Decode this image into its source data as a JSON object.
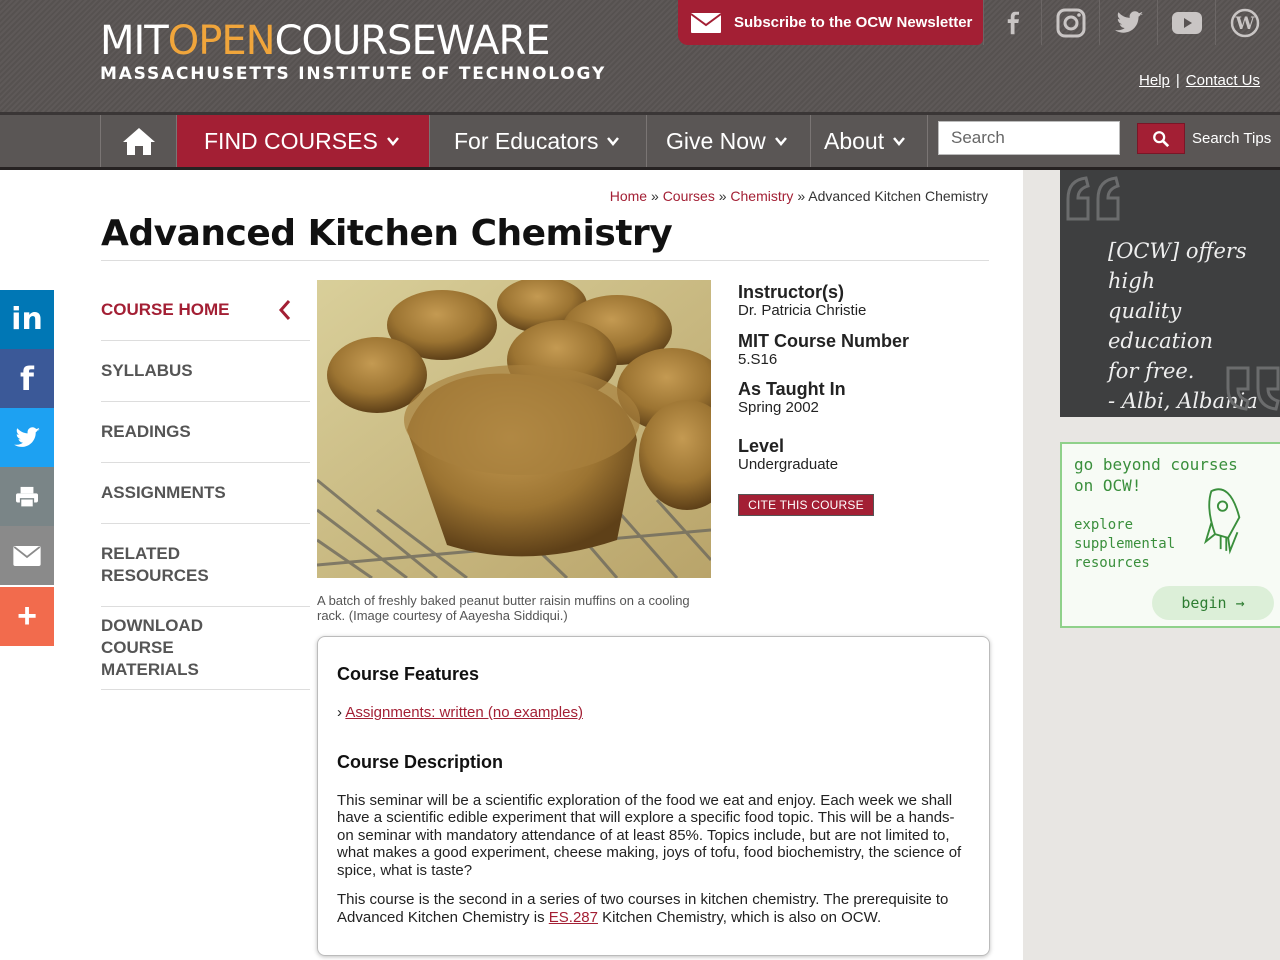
{
  "header": {
    "logo_mit": "MIT",
    "logo_open": "OPEN",
    "logo_courseware": "COURSEWARE",
    "logo_sub": "MASSACHUSETTS INSTITUTE OF TECHNOLOGY",
    "newsletter": "Subscribe to the OCW Newsletter",
    "social_icons": [
      "facebook-icon",
      "instagram-icon",
      "twitter-icon",
      "youtube-icon",
      "wordpress-icon"
    ],
    "help": "Help",
    "separator": "|",
    "contact": "Contact Us"
  },
  "nav": {
    "find_courses": "FIND COURSES",
    "for_educators": "For Educators",
    "give_now": "Give Now",
    "about": "About",
    "search_placeholder": "Search",
    "search_tips": "Search Tips"
  },
  "share": [
    {
      "icon": "linkedin-icon",
      "glyph": "in",
      "color": "#0077b5"
    },
    {
      "icon": "facebook-icon",
      "glyph": "f",
      "color": "#3b5998"
    },
    {
      "icon": "twitter-icon",
      "glyph": "",
      "color": "#1da1f2"
    },
    {
      "icon": "print-icon",
      "glyph": "",
      "color": "#7a8587"
    },
    {
      "icon": "email-icon",
      "glyph": "",
      "color": "#8a8a8a"
    },
    {
      "icon": "more-icon",
      "glyph": "+",
      "color": "#f26b4d"
    }
  ],
  "breadcrumb": {
    "home": "Home",
    "courses": "Courses",
    "chemistry": "Chemistry",
    "sep": "»",
    "current": "Advanced Kitchen Chemistry"
  },
  "page_title": "Advanced Kitchen Chemistry",
  "sidenav": {
    "items": [
      {
        "label": "COURSE HOME"
      },
      {
        "label": "SYLLABUS"
      },
      {
        "label": "READINGS"
      },
      {
        "label": "ASSIGNMENTS"
      },
      {
        "label": "RELATED RESOURCES"
      },
      {
        "label": "DOWNLOAD COURSE MATERIALS"
      }
    ]
  },
  "hero": {
    "caption": "A batch of freshly baked peanut butter raisin muffins on a cooling rack. (Image courtesy of Aayesha Siddiqui.)"
  },
  "meta": {
    "instructor_label": "Instructor(s)",
    "instructor_value": "Dr. Patricia Christie",
    "course_number_label": "MIT Course Number",
    "course_number_value": "5.S16",
    "taught_label": "As Taught In",
    "taught_value": "Spring 2002",
    "level_label": "Level",
    "level_value": "Undergraduate",
    "cite_button": "CITE THIS COURSE"
  },
  "features": {
    "title": "Course Features",
    "bullet": "›",
    "link": "Assignments: written (no examples)",
    "desc_title": "Course Description",
    "para1": "This seminar will be a scientific exploration of the food we eat and enjoy. Each week we shall have a scientific edible experiment that will explore a specific food topic. This will be a hands-on seminar with mandatory attendance of at least 85%. Topics include, but are not limited to, what makes a good experiment, cheese making, joys of tofu, food biochemistry, the science of spice, what is taste?",
    "para2_before": "This course is the second in a series of two courses in kitchen chemistry. The prerequisite to Advanced Kitchen Chemistry is ",
    "para2_link": "ES.287",
    "para2_after": " Kitchen Chemistry, which is also on OCW."
  },
  "promo": {
    "quote_lines": [
      "[OCW] offers high",
      "quality education",
      "for free.",
      "- Albi, Albania"
    ],
    "beyond_line1": "go beyond courses",
    "beyond_line2": "on OCW!",
    "explore_line1": "explore",
    "explore_line2": "supplemental",
    "explore_line3": "resources",
    "begin": "begin →"
  },
  "colors": {
    "accent": "#a31f34",
    "header_bg": "#595453",
    "logo_open": "#f0a53b",
    "promo_green": "#3a8f3c"
  }
}
